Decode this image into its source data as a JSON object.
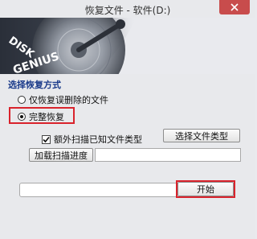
{
  "window": {
    "title": "恢复文件 - 软件(D:)",
    "close_icon": "close-icon"
  },
  "banner": {
    "logo_text": "DISK GENIUS"
  },
  "options": {
    "section_title": "选择恢复方式",
    "radio_deleted_only": "仅恢复误删除的文件",
    "radio_full": "完整恢复",
    "radio_selected": "full"
  },
  "scan": {
    "checkbox_label": "额外扫描已知文件类型",
    "checked": true,
    "select_types_button": "选择文件类型",
    "load_progress_button": "加载扫描进度",
    "progress_path_value": "",
    "status_value": ""
  },
  "footer": {
    "start_button": "开始"
  },
  "colors": {
    "accent_red": "#d9232c",
    "close_red": "#c84c4c",
    "section_blue": "#1a3a8a"
  }
}
